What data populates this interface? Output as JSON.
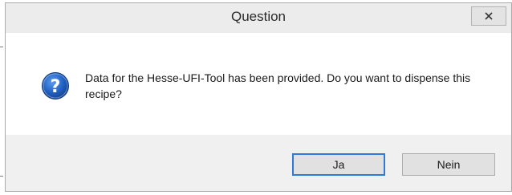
{
  "dialog": {
    "title": "Question",
    "close_symbol": "x",
    "message": "Data for the Hesse-UFI-Tool has been provided. Do you want to dispense this recipe?",
    "icon": "question-icon",
    "buttons": {
      "yes_label": "Ja",
      "no_label": "Nein"
    }
  },
  "colors": {
    "icon_blue": "#1f5fbf",
    "focus_border": "#2f7ad6"
  }
}
